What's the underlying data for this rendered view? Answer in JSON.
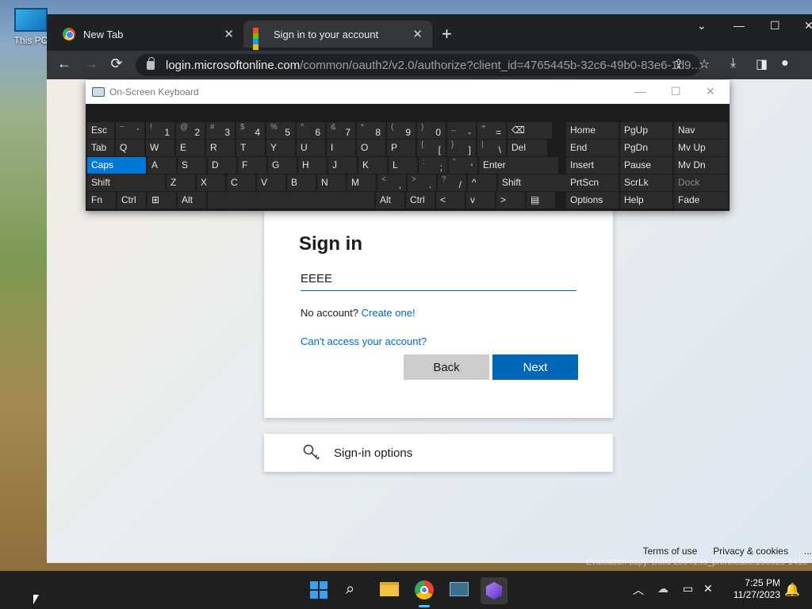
{
  "desktop": {
    "icon_label": "This PC"
  },
  "browser": {
    "tabs": [
      {
        "label": "New Tab",
        "close": "✕"
      },
      {
        "label": "Sign in to your account",
        "close": "✕"
      }
    ],
    "new_tab_glyph": "+",
    "url_host": "login.microsoftonline.com",
    "url_path": "/common/oauth2/v2.0/authorize?client_id=4765445b-32c6-49b0-83e6-1d9...",
    "nav": {
      "back": "←",
      "forward": "→",
      "reload": "⟳"
    }
  },
  "signin": {
    "title": "Sign in",
    "email_value": "EEEE",
    "no_account_text": "No account?",
    "create_link": "Create one!",
    "cant_access": "Can't access your account?",
    "back_label": "Back",
    "next_label": "Next"
  },
  "options": {
    "label": "Sign-in options"
  },
  "footer": {
    "terms": "Terms of use",
    "privacy": "Privacy & cookies",
    "more": "..."
  },
  "watermark": "Evaluation copy. Build 25941.rs_prerelease.230923-1416",
  "osk": {
    "title": "On-Screen Keyboard",
    "rows": [
      [
        {
          "s": "",
          "m": "Esc"
        },
        {
          "s": "~",
          "m": "`"
        },
        {
          "s": "!",
          "m": "1"
        },
        {
          "s": "@",
          "m": "2"
        },
        {
          "s": "#",
          "m": "3"
        },
        {
          "s": "$",
          "m": "4"
        },
        {
          "s": "%",
          "m": "5"
        },
        {
          "s": "^",
          "m": "6"
        },
        {
          "s": "&",
          "m": "7"
        },
        {
          "s": "*",
          "m": "8"
        },
        {
          "s": "(",
          "m": "9"
        },
        {
          "s": ")",
          "m": "0"
        },
        {
          "s": "_",
          "m": "-"
        },
        {
          "s": "+",
          "m": "="
        },
        {
          "s": "",
          "m": "⌫"
        }
      ],
      [
        {
          "s": "",
          "m": "Tab"
        },
        {
          "s": "",
          "m": "Q"
        },
        {
          "s": "",
          "m": "W"
        },
        {
          "s": "",
          "m": "E"
        },
        {
          "s": "",
          "m": "R"
        },
        {
          "s": "",
          "m": "T"
        },
        {
          "s": "",
          "m": "Y"
        },
        {
          "s": "",
          "m": "U"
        },
        {
          "s": "",
          "m": "I"
        },
        {
          "s": "",
          "m": "O"
        },
        {
          "s": "",
          "m": "P"
        },
        {
          "s": "{",
          "m": "["
        },
        {
          "s": "}",
          "m": "]"
        },
        {
          "s": "|",
          "m": "\\"
        },
        {
          "s": "",
          "m": "Del"
        }
      ],
      [
        {
          "s": "",
          "m": "Caps"
        },
        {
          "s": "",
          "m": "A"
        },
        {
          "s": "",
          "m": "S"
        },
        {
          "s": "",
          "m": "D"
        },
        {
          "s": "",
          "m": "F"
        },
        {
          "s": "",
          "m": "G"
        },
        {
          "s": "",
          "m": "H"
        },
        {
          "s": "",
          "m": "J"
        },
        {
          "s": "",
          "m": "K"
        },
        {
          "s": "",
          "m": "L"
        },
        {
          "s": ":",
          "m": ";"
        },
        {
          "s": "\"",
          "m": "'"
        },
        {
          "s": "",
          "m": "Enter"
        }
      ],
      [
        {
          "s": "",
          "m": "Shift"
        },
        {
          "s": "",
          "m": "Z"
        },
        {
          "s": "",
          "m": "X"
        },
        {
          "s": "",
          "m": "C"
        },
        {
          "s": "",
          "m": "V"
        },
        {
          "s": "",
          "m": "B"
        },
        {
          "s": "",
          "m": "N"
        },
        {
          "s": "",
          "m": "M"
        },
        {
          "s": "<",
          "m": ","
        },
        {
          "s": ">",
          "m": "."
        },
        {
          "s": "?",
          "m": "/"
        },
        {
          "s": "",
          "m": "^"
        },
        {
          "s": "",
          "m": "Shift"
        }
      ],
      [
        {
          "s": "",
          "m": "Fn"
        },
        {
          "s": "",
          "m": "Ctrl"
        },
        {
          "s": "",
          "m": "⊞"
        },
        {
          "s": "",
          "m": "Alt"
        },
        {
          "s": "",
          "m": ""
        },
        {
          "s": "",
          "m": "Alt"
        },
        {
          "s": "",
          "m": "Ctrl"
        },
        {
          "s": "",
          "m": "<"
        },
        {
          "s": "",
          "m": "v"
        },
        {
          "s": "",
          "m": ">"
        },
        {
          "s": "",
          "m": "▤"
        }
      ]
    ],
    "nav_cols": [
      [
        "Home",
        "PgUp",
        "Nav"
      ],
      [
        "End",
        "PgDn",
        "Mv Up"
      ],
      [
        "Insert",
        "Pause",
        "Mv Dn"
      ],
      [
        "PrtScn",
        "ScrLk",
        "Dock"
      ],
      [
        "Options",
        "Help",
        "Fade"
      ]
    ]
  },
  "taskbar": {
    "time": "7:25 PM",
    "date": "11/27/2023"
  }
}
